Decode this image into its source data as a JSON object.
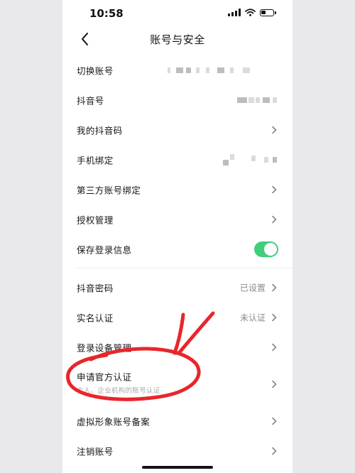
{
  "status_bar": {
    "time": "10:58"
  },
  "nav": {
    "title": "账号与安全",
    "back_icon": "chevron-left-icon"
  },
  "rows": {
    "switch_account": {
      "label": "切换账号"
    },
    "douyin_id": {
      "label": "抖音号"
    },
    "my_qr": {
      "label": "我的抖音码"
    },
    "phone_binding": {
      "label": "手机绑定"
    },
    "third_party_binding": {
      "label": "第三方账号绑定"
    },
    "authorization": {
      "label": "授权管理"
    },
    "save_login": {
      "label": "保存登录信息",
      "enabled": true
    },
    "password": {
      "label": "抖音密码",
      "value": "已设置"
    },
    "real_name": {
      "label": "实名认证",
      "value": "未认证"
    },
    "device_management": {
      "label": "登录设备管理"
    },
    "official_cert": {
      "label": "申请官方认证",
      "sub": "个人、企业机构的账号认证"
    },
    "virtual_avatar": {
      "label": "虚拟形象账号备案"
    },
    "cancel_account": {
      "label": "注销账号"
    }
  },
  "colors": {
    "toggle_on": "#3fce7a",
    "annotation_red": "#e8262b",
    "text_primary": "#161616",
    "text_secondary": "#8a8a8e"
  }
}
